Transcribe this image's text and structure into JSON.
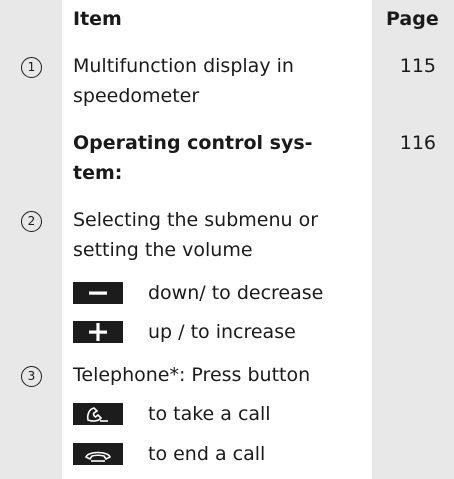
{
  "header": {
    "item": "Item",
    "page": "Page"
  },
  "rows": [
    {
      "marker": "1",
      "lines": [
        "Multifunction display in",
        "speedometer"
      ],
      "page": "115"
    },
    {
      "lines": [
        "Operating control sys-",
        "tem:"
      ],
      "page": "116"
    },
    {
      "marker": "2",
      "lines": [
        "Selecting the submenu or",
        "setting the volume"
      ]
    },
    {
      "icon": "minus-key-icon",
      "text": "down/ to decrease"
    },
    {
      "icon": "plus-key-icon",
      "text": "up / to increase"
    },
    {
      "marker": "3",
      "text": "Telephone*: Press button"
    },
    {
      "icon": "phone-pickup-icon",
      "text": "to take a call"
    },
    {
      "icon": "phone-hangup-icon",
      "text": "to end a call"
    }
  ],
  "colors": {
    "band": "#e8e8e8",
    "key": "#1c1c1c",
    "text": "#1a1a1a"
  }
}
